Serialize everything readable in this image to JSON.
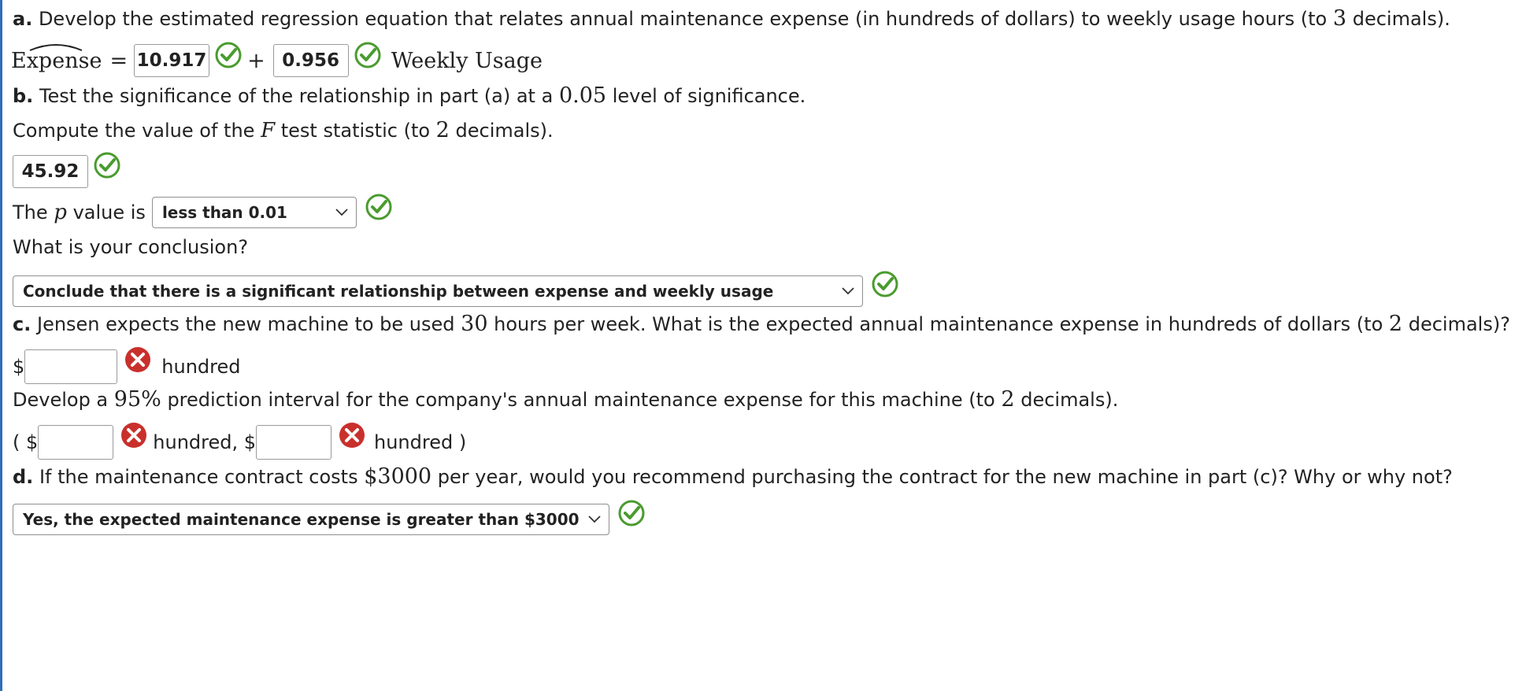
{
  "part_a": {
    "label": "a.",
    "prompt_1": "Develop the estimated regression equation that relates annual maintenance expense (in hundreds of dollars) to weekly usage hours (to",
    "decimals": "3",
    "prompt_2": "decimals).",
    "lhs": "Expense",
    "equals": "=",
    "intercept": "10.917",
    "plus": "+",
    "slope": "0.956",
    "rhs": "Weekly Usage"
  },
  "part_b": {
    "label": "b.",
    "prompt_1": "Test the significance of the relationship in part (a) at a",
    "alpha": "0.05",
    "prompt_2": "level of significance.",
    "f_prompt_1": "Compute the value of the",
    "f_var": "F",
    "f_prompt_2": "test statistic (to",
    "f_decimals": "2",
    "f_prompt_3": "decimals).",
    "f_value": "45.92",
    "p_prompt_1": "The",
    "p_var": "p",
    "p_prompt_2": "value is",
    "p_selected": "less than 0.01",
    "conclusion_prompt": "What is your conclusion?",
    "conclusion_selected": "Conclude that there is a significant relationship between expense and weekly usage"
  },
  "part_c": {
    "label": "c.",
    "prompt_1": "Jensen expects the new machine to be used",
    "hours": "30",
    "prompt_2": "hours per week. What is the expected annual maintenance expense in hundreds of dollars (to",
    "decimals": "2",
    "prompt_3": "decimals)?",
    "dollar": "$",
    "unit": "hundred",
    "pi_prompt_1": "Develop a",
    "pi_level": "95%",
    "pi_prompt_2": "prediction interval for the company's annual maintenance expense for this machine (to",
    "pi_decimals": "2",
    "pi_prompt_3": "decimals).",
    "open_paren": "( $",
    "mid_text": "hundred, $",
    "close_text": "hundred )"
  },
  "part_d": {
    "label": "d.",
    "prompt_1": "If the maintenance contract costs",
    "cost": "$3000",
    "prompt_2": "per year, would you recommend purchasing the contract for the new machine in part (c)? Why or why not?",
    "selected": "Yes, the expected maintenance expense is greater than $3000"
  },
  "colors": {
    "correct": "#4a9b2f",
    "incorrect": "#c9302c",
    "border": "#2f6fb7"
  }
}
